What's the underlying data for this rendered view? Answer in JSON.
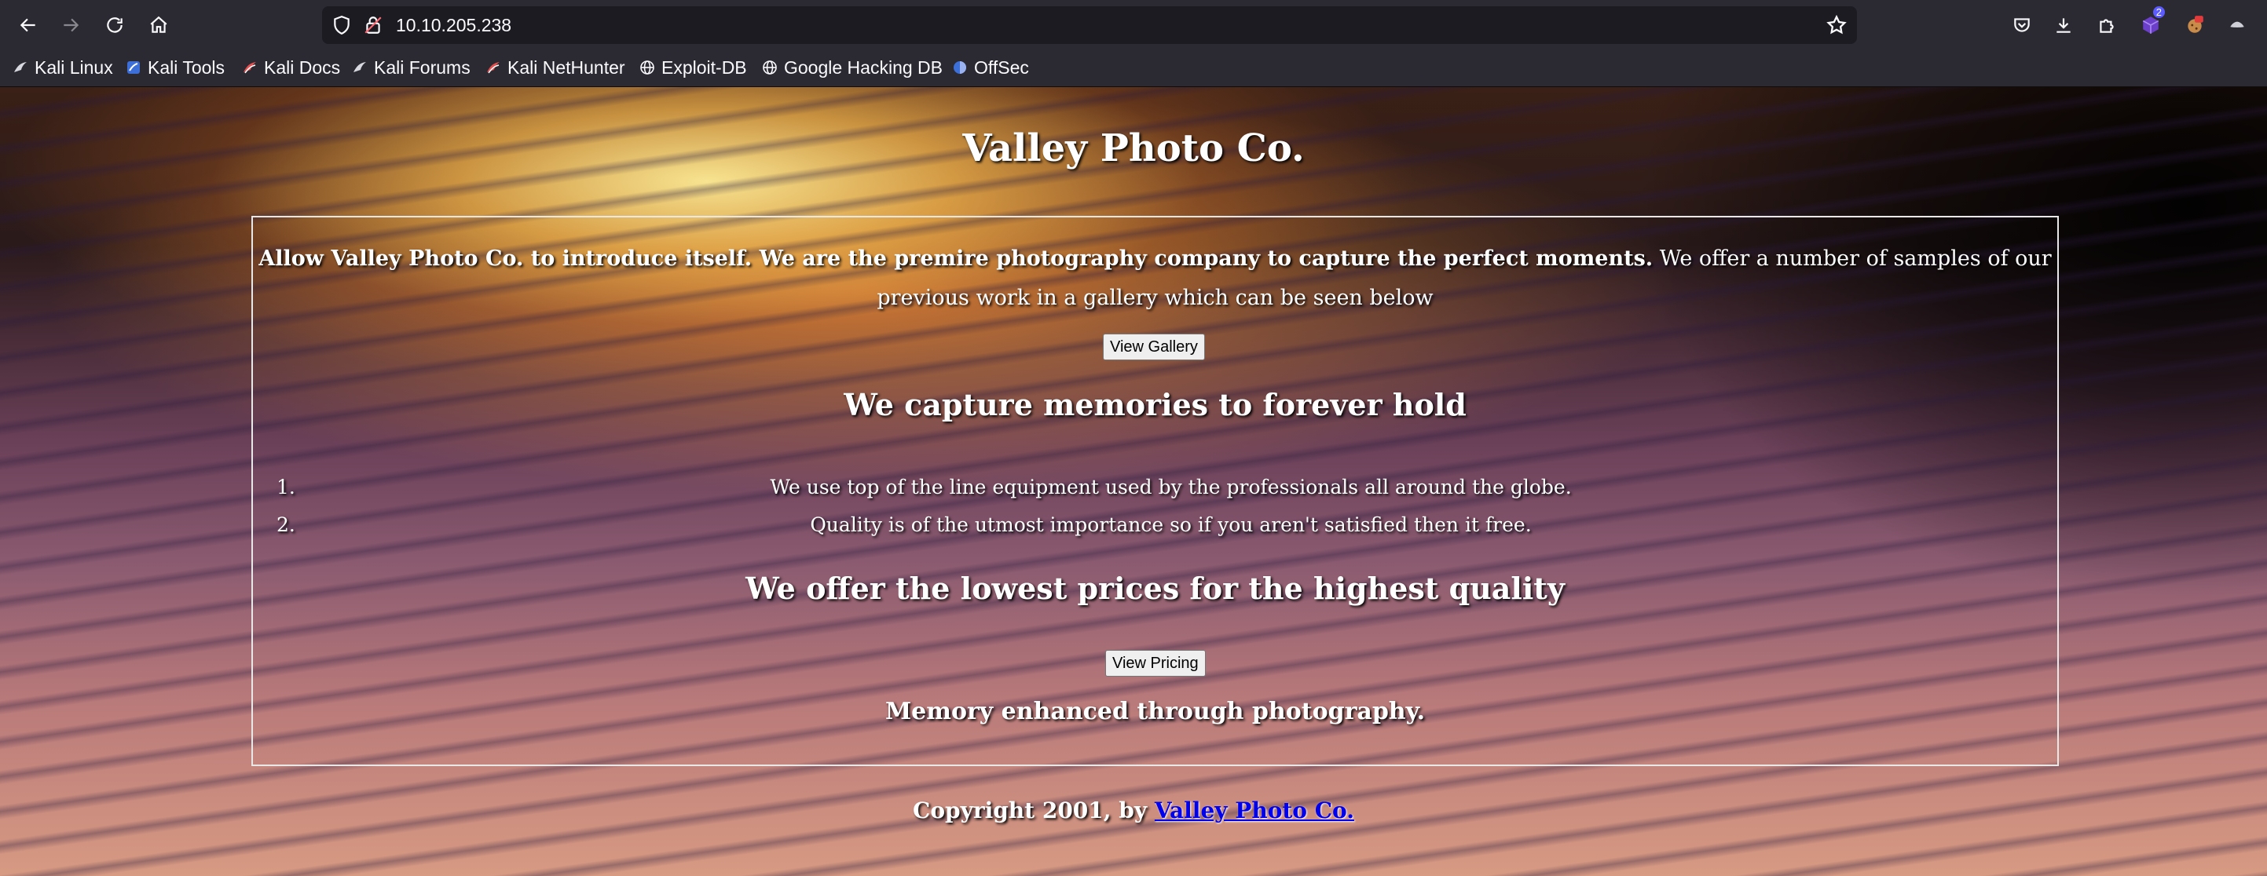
{
  "browser": {
    "url": "10.10.205.238",
    "bookmarks": [
      {
        "label": "Kali Linux",
        "icon": "kali-dragon-icon"
      },
      {
        "label": "Kali Tools",
        "icon": "kali-tools-icon"
      },
      {
        "label": "Kali Docs",
        "icon": "kali-docs-icon"
      },
      {
        "label": "Kali Forums",
        "icon": "kali-dragon-icon"
      },
      {
        "label": "Kali NetHunter",
        "icon": "kali-nethunter-icon"
      },
      {
        "label": "Exploit-DB",
        "icon": "globe-icon"
      },
      {
        "label": "Google Hacking DB",
        "icon": "globe-icon"
      },
      {
        "label": "OffSec",
        "icon": "offsec-icon"
      }
    ],
    "extension_badge": "2"
  },
  "page": {
    "title": "Valley Photo Co.",
    "intro_bold": "Allow Valley Photo Co. to introduce itself. We are the premire photography company to capture the perfect moments.",
    "intro_rest": " We offer a number of samples of our previous work in a gallery which can be seen below",
    "gallery_button": "View Gallery",
    "memories_heading": "We capture memories to forever hold",
    "features": [
      {
        "num": "1.",
        "text": "We use top of the line equipment used by the professionals all around the globe."
      },
      {
        "num": "2.",
        "text": "Quality is of the utmost importance so if you aren't satisfied then it free."
      }
    ],
    "prices_heading": "We offer the lowest prices for the highest quality",
    "pricing_button": "View Pricing",
    "tagline": "Memory enhanced through photography.",
    "footer_prefix": "Copyright 2001, by ",
    "footer_link": "Valley Photo Co."
  }
}
